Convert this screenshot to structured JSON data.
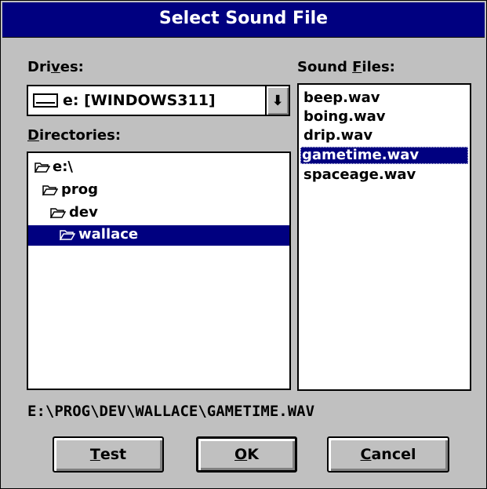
{
  "window": {
    "title": "Select Sound File"
  },
  "drives": {
    "label_pre": "Dri",
    "label_accel": "v",
    "label_post": "es:",
    "selected": "e: [WINDOWS311]",
    "dropdown_arrow": "⬇"
  },
  "directories": {
    "label_accel": "D",
    "label_post": "irectories:",
    "items": [
      {
        "name": "e:\\"
      },
      {
        "name": "prog"
      },
      {
        "name": "dev"
      },
      {
        "name": "wallace",
        "selected": true
      }
    ]
  },
  "sound_files": {
    "label_pre": "Sound ",
    "label_accel": "F",
    "label_post": "iles:",
    "items": [
      {
        "name": "beep.wav"
      },
      {
        "name": "boing.wav"
      },
      {
        "name": "drip.wav"
      },
      {
        "name": "gametime.wav",
        "selected": true
      },
      {
        "name": "spaceage.wav"
      }
    ]
  },
  "path": "E:\\PROG\\DEV\\WALLACE\\GAMETIME.WAV",
  "buttons": {
    "test_accel": "T",
    "test_rest": "est",
    "ok_accel": "O",
    "ok_rest": "K",
    "cancel_accel": "C",
    "cancel_rest": "ancel"
  },
  "colors": {
    "highlight": "#000080",
    "face": "#c0c0c0"
  },
  "icons": {
    "folder_closed": "folder-icon",
    "folder_open": "folder-open-icon",
    "drive": "drive-icon"
  }
}
